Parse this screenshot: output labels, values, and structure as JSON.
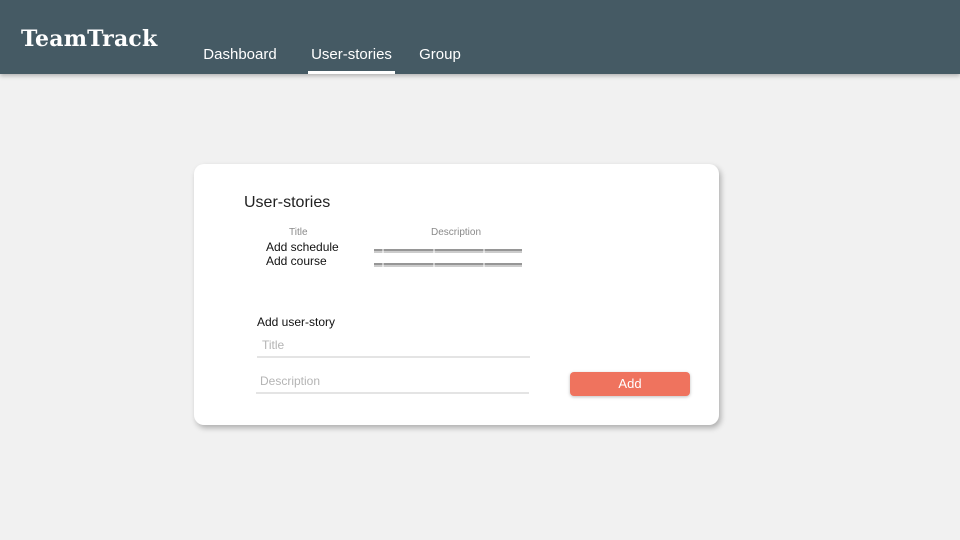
{
  "app": {
    "title": "TeamTrack"
  },
  "nav": {
    "tabs": [
      {
        "label": "Dashboard",
        "active": false
      },
      {
        "label": "User-stories",
        "active": true
      },
      {
        "label": "Group",
        "active": false
      }
    ]
  },
  "card": {
    "title": "User-stories",
    "columns": {
      "title": "Title",
      "description": "Description"
    },
    "rows": [
      {
        "title": "Add schedule",
        "description": ""
      },
      {
        "title": "Add course",
        "description": ""
      }
    ],
    "form": {
      "label": "Add user-story",
      "title_placeholder": "Title",
      "description_placeholder": "Description",
      "add_label": "Add"
    }
  },
  "colors": {
    "topbar": "#455a64",
    "background": "#f1f1f1",
    "accent": "#ef735e"
  }
}
